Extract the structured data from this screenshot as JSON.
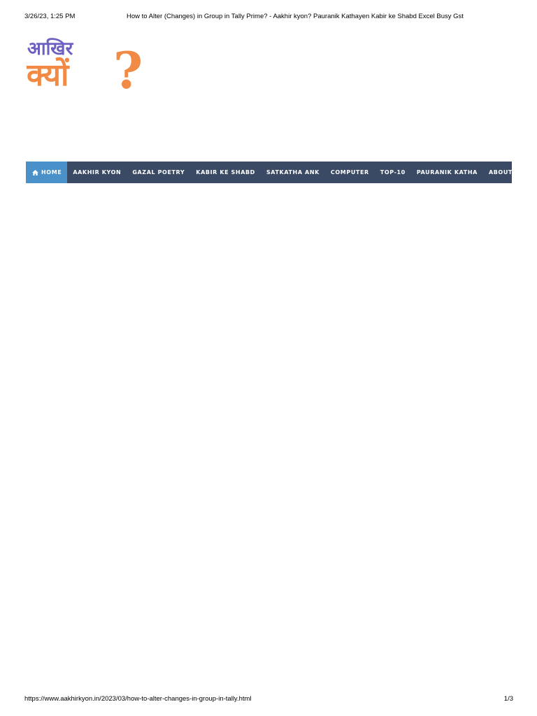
{
  "print_header": {
    "date": "3/26/23, 1:25 PM",
    "title": "How to Alter (Changes) in Group in Tally Prime? - Aakhir kyon? Pauranik Kathayen Kabir ke Shabd Excel Busy Gst"
  },
  "logo": {
    "line1": "आखिर",
    "line2": "क्यों",
    "mark": "?",
    "colors": {
      "line1": "#6b5fc2",
      "line2": "#f08a45",
      "mark": "#f08a45"
    }
  },
  "nav": {
    "colors": {
      "bar": "#3a4a65",
      "active": "#4a90c9",
      "text": "#ffffff"
    },
    "items": [
      {
        "label": "HOME",
        "icon": "home-icon",
        "active": true
      },
      {
        "label": "AAKHIR KYON"
      },
      {
        "label": "GAZAL POETRY"
      },
      {
        "label": "KABIR KE SHABD"
      },
      {
        "label": "SATKATHA ANK"
      },
      {
        "label": "COMPUTER"
      },
      {
        "label": "TOP-10"
      },
      {
        "label": "PAURANIK KATHA"
      },
      {
        "label": "ABOUT US"
      }
    ]
  },
  "print_footer": {
    "url": "https://www.aakhirkyon.in/2023/03/how-to-alter-changes-in-group-in-tally.html",
    "page": "1/3"
  }
}
